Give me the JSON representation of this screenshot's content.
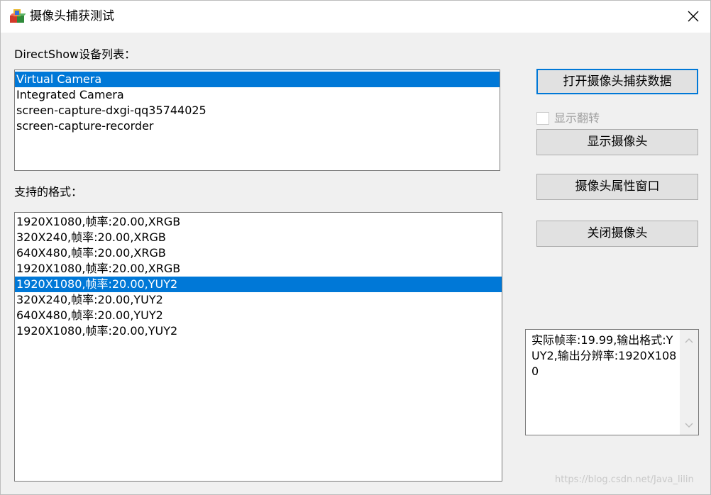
{
  "window": {
    "title": "摄像头捕获测试",
    "accent_color": "#0078d7"
  },
  "devices": {
    "label": "DirectShow设备列表：",
    "items": [
      "Virtual Camera",
      "Integrated Camera",
      "screen-capture-dxgi-qq35744025",
      "screen-capture-recorder"
    ],
    "selected": "Virtual Camera"
  },
  "formats": {
    "label": "支持的格式：",
    "items": [
      "1920X1080,帧率:20.00,XRGB",
      "320X240,帧率:20.00,XRGB",
      "640X480,帧率:20.00,XRGB",
      "1920X1080,帧率:20.00,XRGB",
      "1920X1080,帧率:20.00,YUY2",
      "320X240,帧率:20.00,YUY2",
      "640X480,帧率:20.00,YUY2",
      "1920X1080,帧率:20.00,YUY2"
    ],
    "selected_index": 4
  },
  "buttons": {
    "open_capture": "打开摄像头捕获数据",
    "show_flip": "显示翻转",
    "show_camera": "显示摄像头",
    "properties": "摄像头属性窗口",
    "close_camera": "关闭摄像头"
  },
  "info": {
    "text": "实际帧率:19.99,输出格式:YUY2,输出分辨率:1920X1080"
  },
  "watermark": "https://blog.csdn.net/Java_lilin",
  "icons": {
    "app": "app-cubes-icon",
    "close": "close-icon",
    "scroll_up": "scroll-up-icon",
    "scroll_down": "scroll-down-icon"
  }
}
